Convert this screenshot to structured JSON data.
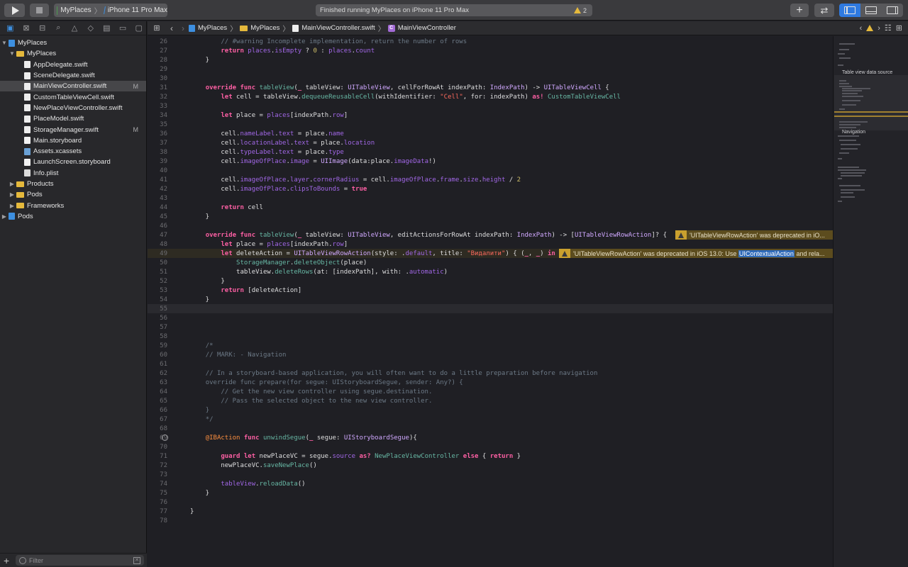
{
  "toolbar": {
    "scheme": "MyPlaces",
    "device": "iPhone 11 Pro Max",
    "activity": "Finished running MyPlaces on iPhone 11 Pro Max",
    "warning_count": "2"
  },
  "navigator": {
    "filter_placeholder": "Filter",
    "tree": [
      {
        "label": "MyPlaces",
        "type": "proj",
        "level": 0,
        "open": "▼"
      },
      {
        "label": "MyPlaces",
        "type": "folder",
        "level": 1,
        "open": "▼"
      },
      {
        "label": "AppDelegate.swift",
        "type": "swift",
        "level": 2
      },
      {
        "label": "SceneDelegate.swift",
        "type": "swift",
        "level": 2
      },
      {
        "label": "MainViewController.swift",
        "type": "swift",
        "level": 2,
        "mod": "M",
        "selected": true
      },
      {
        "label": "CustomTableViewCell.swift",
        "type": "swift",
        "level": 2
      },
      {
        "label": "NewPlaceViewController.swift",
        "type": "swift",
        "level": 2
      },
      {
        "label": "PlaceModel.swift",
        "type": "swift",
        "level": 2
      },
      {
        "label": "StorageManager.swift",
        "type": "swift",
        "level": 2,
        "mod": "M"
      },
      {
        "label": "Main.storyboard",
        "type": "sb",
        "level": 2
      },
      {
        "label": "Assets.xcassets",
        "type": "assets",
        "level": 2
      },
      {
        "label": "LaunchScreen.storyboard",
        "type": "sb",
        "level": 2
      },
      {
        "label": "Info.plist",
        "type": "plist",
        "level": 2
      },
      {
        "label": "Products",
        "type": "folder",
        "level": 1,
        "open": "▶"
      },
      {
        "label": "Pods",
        "type": "folder",
        "level": 1,
        "open": "▶"
      },
      {
        "label": "Frameworks",
        "type": "folder",
        "level": 1,
        "open": "▶"
      },
      {
        "label": "Pods",
        "type": "proj",
        "level": 0,
        "open": "▶"
      }
    ]
  },
  "jumpbar": {
    "crumbs": [
      "MyPlaces",
      "MyPlaces",
      "MainViewController.swift",
      "MainViewController"
    ]
  },
  "editor": {
    "lines": [
      {
        "n": "26",
        "h": "        <span class='c'>// #warning Incomplete implementation, return the number of rows</span>"
      },
      {
        "n": "27",
        "h": "        <span class='k'>return</span> <span class='p'>places</span>.<span class='p'>isEmpty</span> ? <span class='n'>0</span> : <span class='p'>places</span>.<span class='p'>count</span>"
      },
      {
        "n": "28",
        "h": "    }"
      },
      {
        "n": "29",
        "h": ""
      },
      {
        "n": "30",
        "h": ""
      },
      {
        "n": "31",
        "h": "    <span class='k'>override</span> <span class='k'>func</span> <span class='f'>tableView</span>(<span class='k'>_</span> tableView: <span class='t'>UITableView</span>, cellForRowAt indexPath: <span class='t'>IndexPath</span>) -> <span class='t'>UITableViewCell</span> {"
      },
      {
        "n": "32",
        "h": "        <span class='k'>let</span> cell = tableView.<span class='f'>dequeueReusableCell</span>(withIdentifier: <span class='s'>\"Cell\"</span>, for: indexPath) <span class='k'>as!</span> <span class='f'>CustomTableViewCell</span>"
      },
      {
        "n": "33",
        "h": ""
      },
      {
        "n": "34",
        "h": "        <span class='k'>let</span> place = <span class='p'>places</span>[indexPath.<span class='p'>row</span>]"
      },
      {
        "n": "35",
        "h": ""
      },
      {
        "n": "36",
        "h": "        cell.<span class='p'>nameLabel</span>.<span class='p'>text</span> = place.<span class='p'>name</span>"
      },
      {
        "n": "37",
        "h": "        cell.<span class='p'>locationLabel</span>.<span class='p'>text</span> = place.<span class='p'>location</span>"
      },
      {
        "n": "38",
        "h": "        cell.<span class='p'>typeLabel</span>.<span class='p'>text</span> = place.<span class='p'>type</span>"
      },
      {
        "n": "39",
        "h": "        cell.<span class='p'>imageOfPlace</span>.<span class='p'>image</span> = <span class='t'>UIImage</span>(data:place.<span class='p'>imageData</span>!)"
      },
      {
        "n": "40",
        "h": ""
      },
      {
        "n": "41",
        "h": "        cell.<span class='p'>imageOfPlace</span>.<span class='p'>layer</span>.<span class='p'>cornerRadius</span> = cell.<span class='p'>imageOfPlace</span>.<span class='p'>frame</span>.<span class='p'>size</span>.<span class='p'>height</span> / <span class='n'>2</span>"
      },
      {
        "n": "42",
        "h": "        cell.<span class='p'>imageOfPlace</span>.<span class='p'>clipsToBounds</span> = <span class='k'>true</span>"
      },
      {
        "n": "43",
        "h": ""
      },
      {
        "n": "44",
        "h": "        <span class='k'>return</span> cell"
      },
      {
        "n": "45",
        "h": "    }"
      },
      {
        "n": "46",
        "h": ""
      },
      {
        "n": "47",
        "chg": true,
        "issue": "'UITableViewRowAction' was deprecated in iO...",
        "issueLeft": 744,
        "h": "    <span class='k'>override</span> <span class='k'>func</span> <span class='f'>tableView</span>(<span class='k'>_</span> tableView: <span class='t'>UITableView</span>, editActionsForRowAt indexPath: <span class='t'>IndexPath</span>) -> [<span class='t'>UITableViewRowAction</span>]? {"
      },
      {
        "n": "48",
        "chg": true,
        "h": "        <span class='k'>let</span> place = <span class='p'>places</span>[indexPath.<span class='p'>row</span>]"
      },
      {
        "n": "49",
        "chg": true,
        "hl": true,
        "issue": "'UITableViewRowAction' was deprecated in iOS 13.0: Use ",
        "issueWord": "UIContextualAction",
        "issueTail": " and rela...",
        "issueLeft": 580,
        "h": "        <span class='k'>let</span> deleteAction = <span class='t'>UITableViewRowAction</span>(style: .<span class='p'>default</span>, title: <span class='s'>\"Видалити\"</span>) { (<span class='k'>_</span>, <span class='k'>_</span>) <span class='k'>in</span>"
      },
      {
        "n": "50",
        "chg": true,
        "h": "            <span class='f'>StorageManager</span>.<span class='f'>deleteObject</span>(place)"
      },
      {
        "n": "51",
        "chg": true,
        "h": "            tableView.<span class='f'>deleteRows</span>(at: [indexPath], with: .<span class='p'>automatic</span>)"
      },
      {
        "n": "52",
        "chg": true,
        "h": "        }"
      },
      {
        "n": "53",
        "chg": true,
        "h": "        <span class='k'>return</span> [deleteAction]"
      },
      {
        "n": "54",
        "chg": true,
        "h": "    }"
      },
      {
        "n": "55",
        "chg": true,
        "cur": true,
        "h": ""
      },
      {
        "n": "56",
        "h": ""
      },
      {
        "n": "57",
        "h": ""
      },
      {
        "n": "58",
        "h": ""
      },
      {
        "n": "59",
        "h": "    <span class='c'>/*</span>"
      },
      {
        "n": "60",
        "h": "    <span class='c'>// MARK: - Navigation</span>"
      },
      {
        "n": "61",
        "h": ""
      },
      {
        "n": "62",
        "h": "    <span class='c'>// In a storyboard-based application, you will often want to do a little preparation before navigation</span>"
      },
      {
        "n": "63",
        "h": "    <span class='c'>override func prepare(for segue: UIStoryboardSegue, sender: Any?) {</span>"
      },
      {
        "n": "64",
        "h": "        <span class='c'>// Get the new view controller using segue.destination.</span>"
      },
      {
        "n": "65",
        "h": "        <span class='c'>// Pass the selected object to the new view controller.</span>"
      },
      {
        "n": "66",
        "h": "    <span class='c'>}</span>"
      },
      {
        "n": "67",
        "h": "    <span class='c'>*/</span>"
      },
      {
        "n": "68",
        "h": ""
      },
      {
        "n": "69",
        "bp": true,
        "h": "    <span class='ib'>@IBAction</span> <span class='k'>func</span> <span class='f'>unwindSegue</span>(<span class='k'>_</span> segue: <span class='t'>UIStoryboardSegue</span>){"
      },
      {
        "n": "70",
        "h": ""
      },
      {
        "n": "71",
        "h": "        <span class='k'>guard</span> <span class='k'>let</span> newPlaceVC = segue.<span class='p'>source</span> <span class='k'>as?</span> <span class='f'>NewPlaceViewController</span> <span class='k'>else</span> { <span class='k'>return</span> }"
      },
      {
        "n": "72",
        "h": "        newPlaceVC.<span class='f'>saveNewPlace</span>()"
      },
      {
        "n": "73",
        "h": ""
      },
      {
        "n": "74",
        "h": "        <span class='p'>tableView</span>.<span class='f'>reloadData</span>()"
      },
      {
        "n": "75",
        "h": "    }"
      },
      {
        "n": "76",
        "h": ""
      },
      {
        "n": "77",
        "h": "}"
      },
      {
        "n": "78",
        "h": ""
      }
    ]
  },
  "minimap": {
    "labels": [
      "Table view data source",
      "Navigation"
    ]
  },
  "colors": {
    "accent": "#3d8fe0",
    "warning": "#e5b93c",
    "editor_bg": "#1f1f24"
  }
}
